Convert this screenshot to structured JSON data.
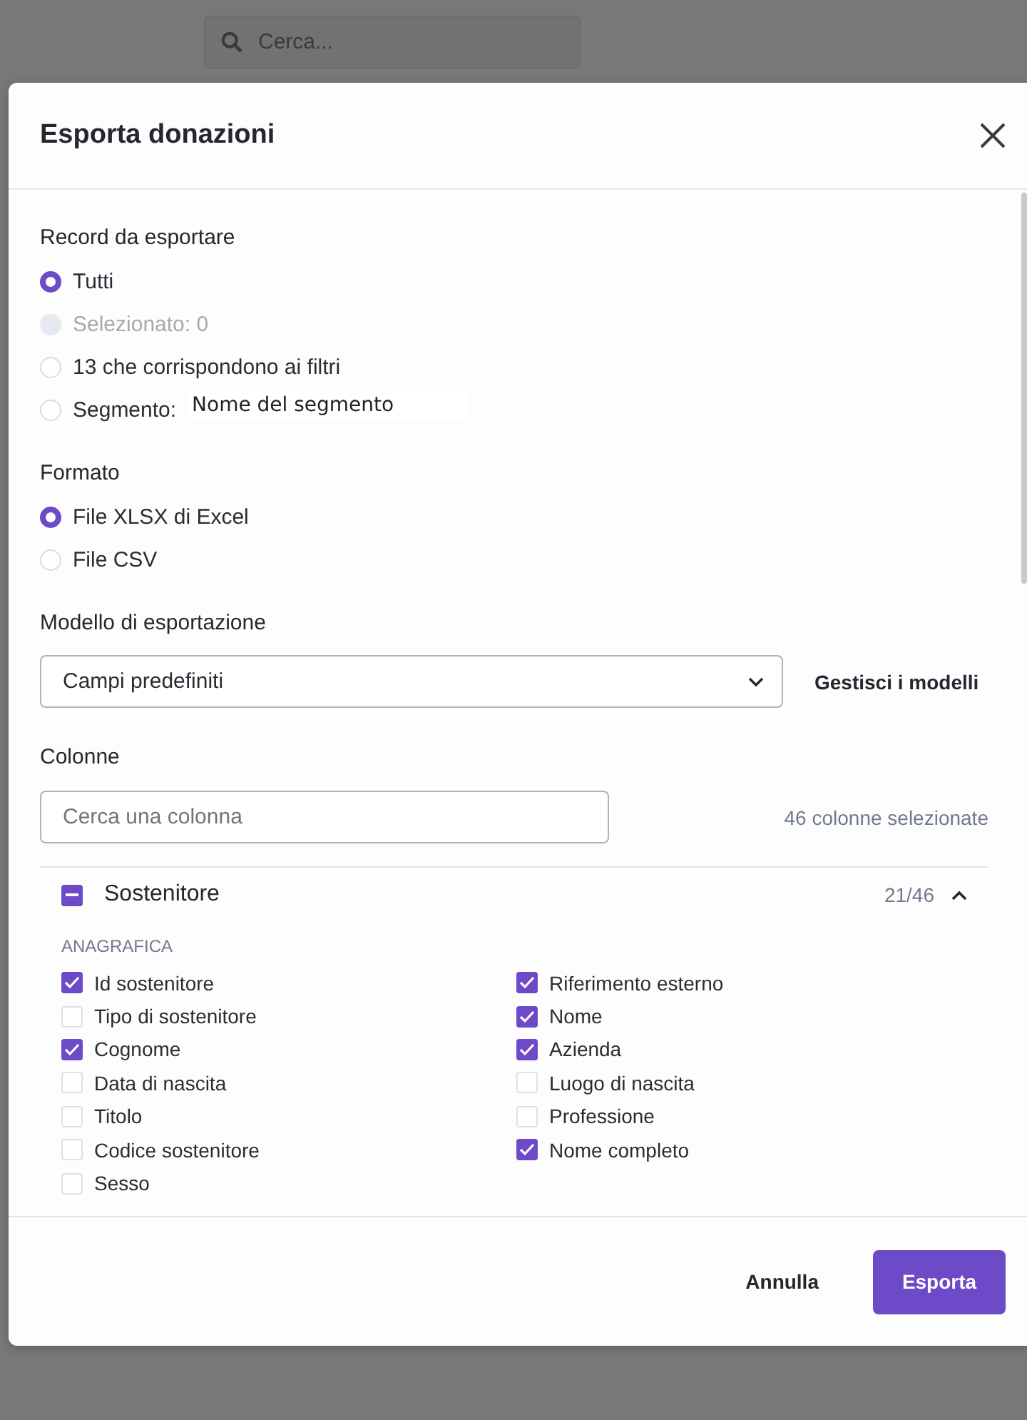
{
  "background": {
    "search": {
      "placeholder": "Cerca..."
    }
  },
  "dialog": {
    "title": "Esporta donazioni",
    "records": {
      "label": "Record da esportare",
      "options": [
        {
          "label": "Tutti",
          "selected": true,
          "disabled": false
        },
        {
          "label": "Selezionato: 0",
          "selected": false,
          "disabled": true
        },
        {
          "label": "13 che corrispondono ai filtri",
          "selected": false,
          "disabled": false
        },
        {
          "label": "Segmento:",
          "selected": false,
          "disabled": false,
          "field": {
            "value": "Nome del segmento"
          }
        }
      ]
    },
    "format": {
      "label": "Formato",
      "options": [
        {
          "label": "File XLSX di Excel",
          "selected": true,
          "disabled": false
        },
        {
          "label": "File CSV",
          "selected": false,
          "disabled": false
        }
      ]
    },
    "template": {
      "label": "Modello di esportazione",
      "value": "Campi predefiniti",
      "manage": "Gestisci i modelli"
    },
    "columns": {
      "label": "Colonne",
      "search": {
        "placeholder": "Cerca una colonna"
      },
      "count": "46 colonne selezionate",
      "group": {
        "name": "Sostenitore",
        "checked": true,
        "partial": true,
        "count": "21/46",
        "expanded": true,
        "section": "ANAGRAFICA",
        "field_columns": [
          {
            "fields": [
              {
                "label": "Id sostenitore",
                "checked": true
              },
              {
                "label": "Tipo di sostenitore",
                "checked": false
              },
              {
                "label": "Cognome",
                "checked": true
              },
              {
                "label": "Data di nascita",
                "checked": false
              },
              {
                "label": "Titolo",
                "checked": false
              },
              {
                "label": "Codice sostenitore",
                "checked": false
              },
              {
                "label": "Sesso",
                "checked": false
              }
            ]
          },
          {
            "fields": [
              {
                "label": "Riferimento esterno",
                "checked": true
              },
              {
                "label": "Nome",
                "checked": true
              },
              {
                "label": "Azienda",
                "checked": true
              },
              {
                "label": "Luogo di nascita",
                "checked": false
              },
              {
                "label": "Professione",
                "checked": false
              },
              {
                "label": "Nome completo",
                "checked": true
              }
            ]
          }
        ]
      }
    },
    "footer": {
      "cancel": "Annulla",
      "confirm": "Esporta"
    }
  }
}
